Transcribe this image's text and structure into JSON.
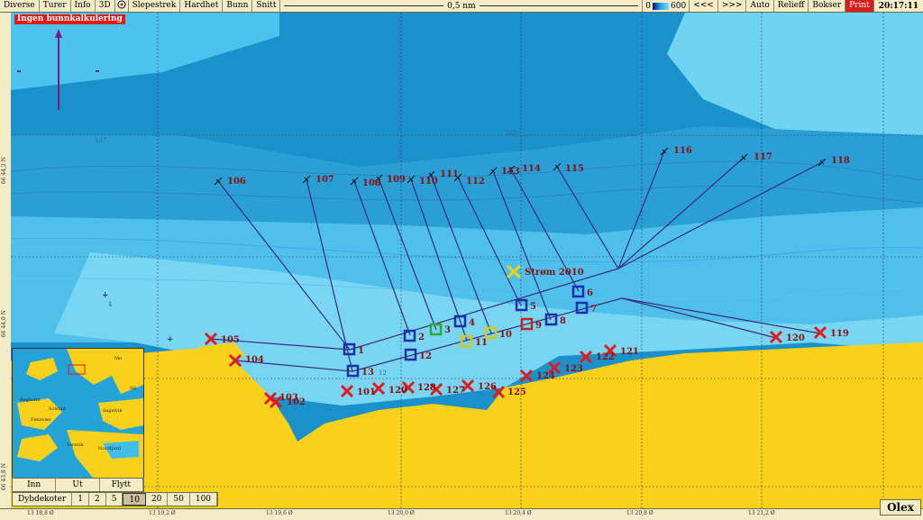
{
  "toolbar": {
    "menu_items": [
      "Diverse",
      "Turer",
      "Info",
      "3D",
      "Slepestrek",
      "Hardhet",
      "Bunn",
      "Snitt"
    ],
    "scale_label": "0,5 nm",
    "depth_min": "0",
    "depth_max": "600",
    "nav_items": [
      "<<<",
      ">>>",
      "Auto",
      "Relieff",
      "Bokser"
    ],
    "print_label": "Print",
    "time": "20:17:11"
  },
  "badge_nocalc": "Ingen bunnkalkulering",
  "colors": {
    "land": "#f9d11a",
    "shallow": "#7ad9f5",
    "deep": "#1a8fc8",
    "track": "#3a2a7a",
    "cross": "#e11b1b"
  },
  "lat_labels": [
    "66 44,2 N",
    "66 44,0 N",
    "66 43,8 N"
  ],
  "lon_labels": [
    "13 18,8 Ø",
    "13 19,2 Ø",
    "13 19,6 Ø",
    "13 20,0 Ø",
    "13 20,4 Ø",
    "13 20,8 Ø",
    "13 21,2 Ø"
  ],
  "map": {
    "strom_label": "Strøm 2010",
    "hooks": [
      "106",
      "107",
      "108",
      "109",
      "110",
      "111",
      "112",
      "113",
      "114",
      "115",
      "116",
      "117",
      "118"
    ],
    "crosses": [
      "105",
      "104",
      "102",
      "103",
      "101",
      "120",
      "128",
      "127",
      "126",
      "125",
      "124",
      "123",
      "122",
      "121",
      "120",
      "119"
    ],
    "box_labels": [
      "1",
      "2",
      "3",
      "4",
      "5",
      "6",
      "7",
      "8",
      "9",
      "10",
      "11",
      "12",
      "13"
    ],
    "contour_small_labels": [
      "137",
      "202",
      "4",
      "12"
    ]
  },
  "minimap": {
    "place_labels": [
      "Mo",
      "Sti",
      "Bøgholm",
      "Solstad",
      "Fleinvær",
      "Sagelvik",
      "Torsvik",
      "Nordfjord"
    ]
  },
  "mini_buttons": [
    "Inn",
    "Ut",
    "Flytt"
  ],
  "contour_bar": {
    "label": "Dybdekoter",
    "values": [
      "1",
      "2",
      "5",
      "10",
      "20",
      "50",
      "100"
    ],
    "active": "10"
  },
  "brand": "Olex"
}
